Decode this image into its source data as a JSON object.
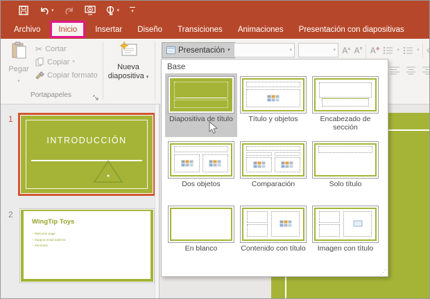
{
  "quick_access_toolbar": {
    "icons": [
      "save",
      "undo",
      "redo",
      "start-from-beginning",
      "touch-mouse-mode",
      "customize-quick-access-toolbar"
    ]
  },
  "tabs": {
    "items": [
      {
        "label": "Archivo",
        "active": false
      },
      {
        "label": "Inicio",
        "active": true
      },
      {
        "label": "Insertar",
        "active": false
      },
      {
        "label": "Diseño",
        "active": false
      },
      {
        "label": "Transiciones",
        "active": false
      },
      {
        "label": "Animaciones",
        "active": false
      },
      {
        "label": "Presentación con diapositivas",
        "active": false
      }
    ]
  },
  "ribbon": {
    "paste": "Pegar",
    "cut": "Cortar",
    "copy": "Copiar",
    "format_painter": "Copiar formato",
    "clipboard_group": "Portapapeles",
    "new_slide": "Nueva diapositiva",
    "layout_button": "Presentación"
  },
  "layout_gallery": {
    "header": "Base",
    "items": [
      {
        "label": "Diapositiva de título",
        "style": "title-slide",
        "selected": true
      },
      {
        "label": "Título y objetos",
        "style": "title-content",
        "selected": false
      },
      {
        "label": "Encabezado de sección",
        "style": "section-header",
        "selected": false
      },
      {
        "label": "Dos objetos",
        "style": "two-content",
        "selected": false
      },
      {
        "label": "Comparación",
        "style": "comparison",
        "selected": false
      },
      {
        "label": "Solo título",
        "style": "title-only",
        "selected": false
      },
      {
        "label": "En blanco",
        "style": "blank",
        "selected": false
      },
      {
        "label": "Contenido con título",
        "style": "content-caption",
        "selected": false
      },
      {
        "label": "Imagen con título",
        "style": "picture-caption",
        "selected": false
      }
    ]
  },
  "slides": [
    {
      "number": "1",
      "title": "INTRODUCCIÓN",
      "selected": true
    },
    {
      "number": "2",
      "title": "WingTip Toys",
      "bullets": [
        "Welcome page",
        "Support email address",
        "Summary"
      ],
      "selected": false
    }
  ],
  "colors": {
    "title_bar": "#b7472a",
    "highlight_box": "#e3188c",
    "theme_green": "#a5b437",
    "selected_slide_border": "#d2552f"
  }
}
